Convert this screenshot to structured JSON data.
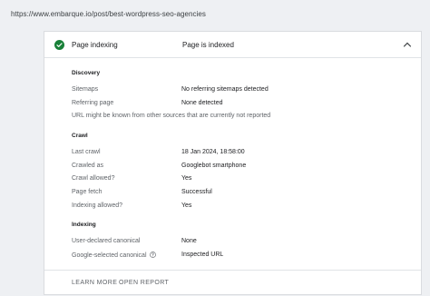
{
  "url": "https://www.embarque.io/post/best-wordpress-seo-agencies",
  "header": {
    "label": "Page indexing",
    "status": "Page is indexed",
    "status_color": "#188038"
  },
  "discovery": {
    "title": "Discovery",
    "sitemaps_label": "Sitemaps",
    "sitemaps_value": "No referring sitemaps detected",
    "referring_label": "Referring page",
    "referring_value": "None detected",
    "note": "URL might be known from other sources that are currently not reported"
  },
  "crawl": {
    "title": "Crawl",
    "last_crawl_label": "Last crawl",
    "last_crawl_value": "18 Jan 2024, 18:58:00",
    "crawled_as_label": "Crawled as",
    "crawled_as_value": "Googlebot smartphone",
    "crawl_allowed_label": "Crawl allowed?",
    "crawl_allowed_value": "Yes",
    "page_fetch_label": "Page fetch",
    "page_fetch_value": "Successful",
    "indexing_allowed_label": "Indexing allowed?",
    "indexing_allowed_value": "Yes"
  },
  "indexing": {
    "title": "Indexing",
    "user_canonical_label": "User-declared canonical",
    "user_canonical_value": "None",
    "google_canonical_label": "Google-selected canonical",
    "google_canonical_value": "Inspected URL"
  },
  "footer": {
    "learn_more": "LEARN MORE",
    "open_report": "OPEN REPORT"
  }
}
